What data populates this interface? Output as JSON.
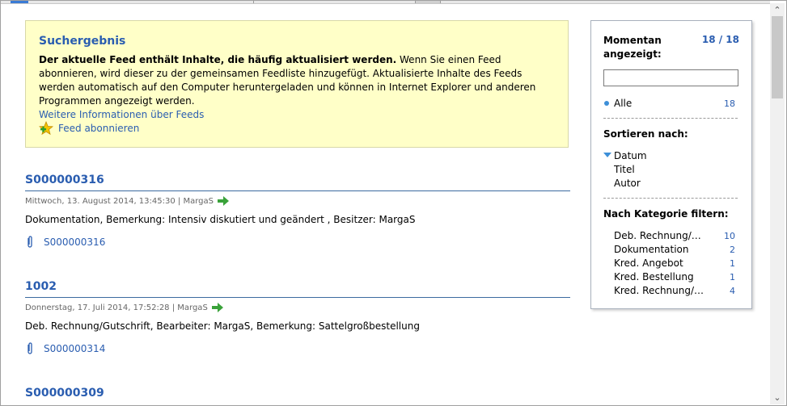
{
  "info": {
    "title": "Suchergebnis",
    "bold_text": "Der aktuelle Feed enthält Inhalte, die häufig aktualisiert werden.",
    "text": " Wenn Sie einen Feed abonnieren, wird dieser zu der gemeinsamen Feedliste hinzugefügt. Aktualisierte Inhalte des Feeds werden automatisch auf den Computer heruntergeladen und können in Internet Explorer und anderen Programmen angezeigt werden.",
    "more_link": "Weitere Informationen über Feeds",
    "subscribe": "Feed abonnieren"
  },
  "items": [
    {
      "title": "S000000316",
      "meta": "Mittwoch, 13. August 2014, 13:45:30 | MargaS",
      "desc": "Dokumentation, Bemerkung: Intensiv diskutiert und geändert , Besitzer: MargaS",
      "attachment": "S000000316"
    },
    {
      "title": "1002",
      "meta": "Donnerstag, 17. Juli 2014, 17:52:28 | MargaS",
      "desc": "Deb. Rechnung/Gutschrift, Bearbeiter: MargaS, Bemerkung: Sattelgroßbestellung",
      "attachment": "S000000314"
    },
    {
      "title": "S000000309"
    }
  ],
  "panel": {
    "shown_label": "Momentan angezeigt:",
    "shown_count": "18 / 18",
    "search_value": "",
    "all_label": "Alle",
    "all_count": "18",
    "sort_label": "Sortieren nach:",
    "sort_options": [
      "Datum",
      "Titel",
      "Autor"
    ],
    "filter_label": "Nach Kategorie filtern:",
    "categories": [
      {
        "name": "Deb. Rechnung/Gutschrift",
        "count": "10"
      },
      {
        "name": "Dokumentation",
        "count": "2"
      },
      {
        "name": "Kred. Angebot",
        "count": "1"
      },
      {
        "name": "Kred. Bestellung",
        "count": "1"
      },
      {
        "name": "Kred. Rechnung/Gutschrift",
        "count": "4"
      }
    ]
  },
  "colors": {
    "link": "#2a5db0",
    "infobox_bg": "#ffffc8",
    "accent_dot": "#3d8fd8"
  },
  "icons": {
    "subscribe": "feed-star-icon",
    "meta_arrow": "green-arrow-icon",
    "attachment": "paperclip-icon"
  }
}
